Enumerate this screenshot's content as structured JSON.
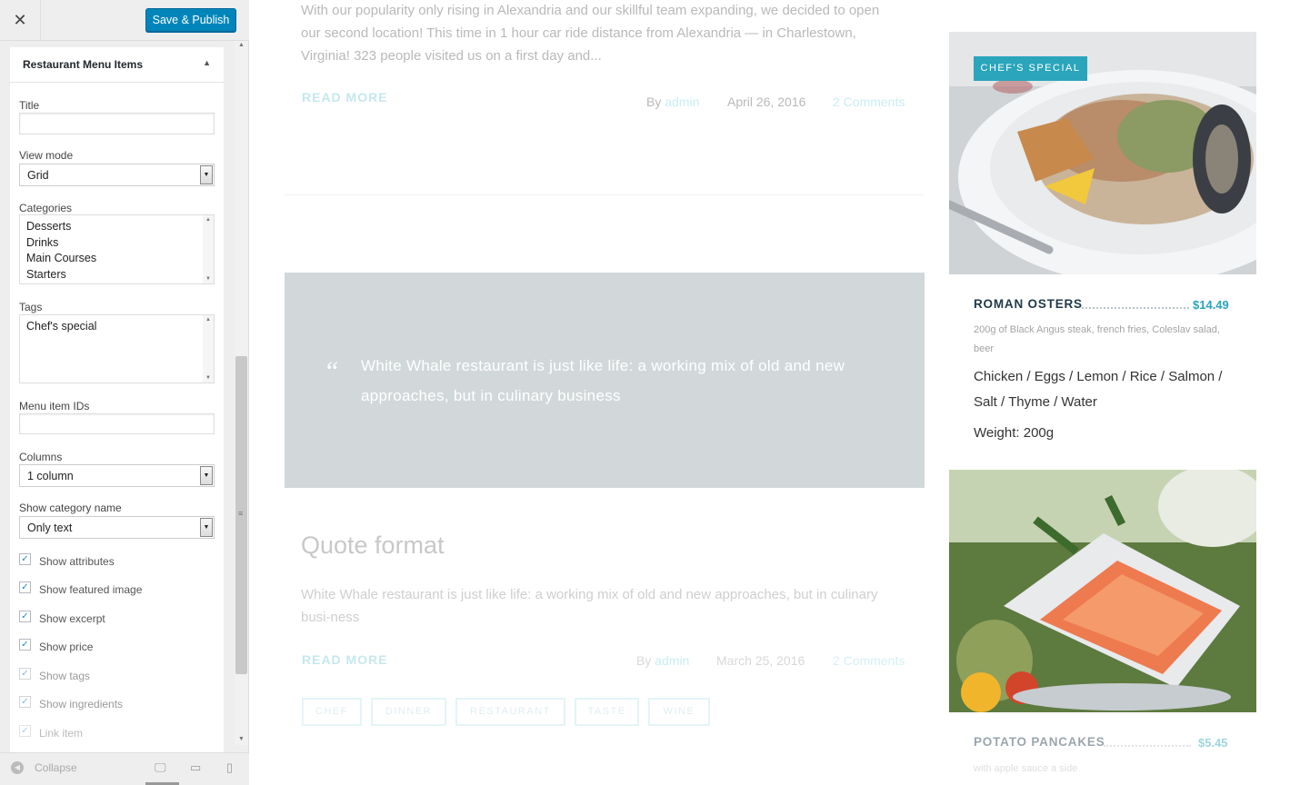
{
  "header": {
    "close_icon": "close-icon",
    "publish_label": "Save & Publish"
  },
  "section": {
    "title": "Restaurant Menu Items"
  },
  "form": {
    "title_label": "Title",
    "title_value": "",
    "view_mode_label": "View mode",
    "view_mode_value": "Grid",
    "categories_label": "Categories",
    "categories": [
      "Desserts",
      "Drinks",
      "Main Courses",
      "Starters"
    ],
    "tags_label": "Tags",
    "tags": [
      "Chef's special"
    ],
    "menu_ids_label": "Menu item IDs",
    "menu_ids_value": "",
    "columns_label": "Columns",
    "columns_value": "1 column",
    "show_category_label": "Show category name",
    "show_category_value": "Only text",
    "checkboxes": [
      {
        "label": "Show attributes",
        "checked": true
      },
      {
        "label": "Show featured image",
        "checked": true
      },
      {
        "label": "Show excerpt",
        "checked": true
      },
      {
        "label": "Show price",
        "checked": true
      },
      {
        "label": "Show tags",
        "checked": true
      },
      {
        "label": "Show ingredients",
        "checked": true
      },
      {
        "label": "Link item",
        "checked": true
      }
    ]
  },
  "footer": {
    "collapse_label": "Collapse"
  },
  "preview": {
    "post1_excerpt": "With our popularity only rising in Alexandria and our skillful team expanding, we decided to open our second location! This time in 1 hour car ride distance from Alexandria — in Charlestown, Virginia! 323 people visited us on a first day and...",
    "read_more": "READ MORE",
    "post1_by": "By",
    "post1_author": "admin",
    "post1_date": "April 26, 2016",
    "post1_comments": "2 Comments",
    "quote_mark": "“",
    "quote_text": "White Whale restaurant is just like life: a working mix of old and new approaches, but in culinary business",
    "post2_title": "Quote format",
    "post2_excerpt": "White Whale restaurant is just like life: a working mix of old and new approaches, but in culinary busi-ness",
    "post2_by": "By",
    "post2_author": "admin",
    "post2_date": "March 25, 2016",
    "post2_comments": "2 Comments",
    "tags": [
      "CHEF",
      "DINNER",
      "RESTAURANT",
      "TASTE",
      "WINE"
    ]
  },
  "menu": {
    "badge": "CHEF'S SPECIAL",
    "item1_name": "ROMAN OSTERS",
    "item1_price": "$14.49",
    "item1_desc": "200g of Black Angus steak, french fries, Coleslav salad, beer",
    "item1_ingredients": "Chicken  /  Eggs  /  Lemon  /  Rice  /  Salmon  /  Salt  /  Thyme  /  Water",
    "item1_weight": "Weight: 200g",
    "item2_name": "POTATO PANCAKES",
    "item2_price": "$5.45",
    "item2_desc": "with apple sauce a side"
  },
  "colors": {
    "accent": "#2aa5bb",
    "publish": "#0085ba",
    "quote_bg": "#d2d8da"
  }
}
